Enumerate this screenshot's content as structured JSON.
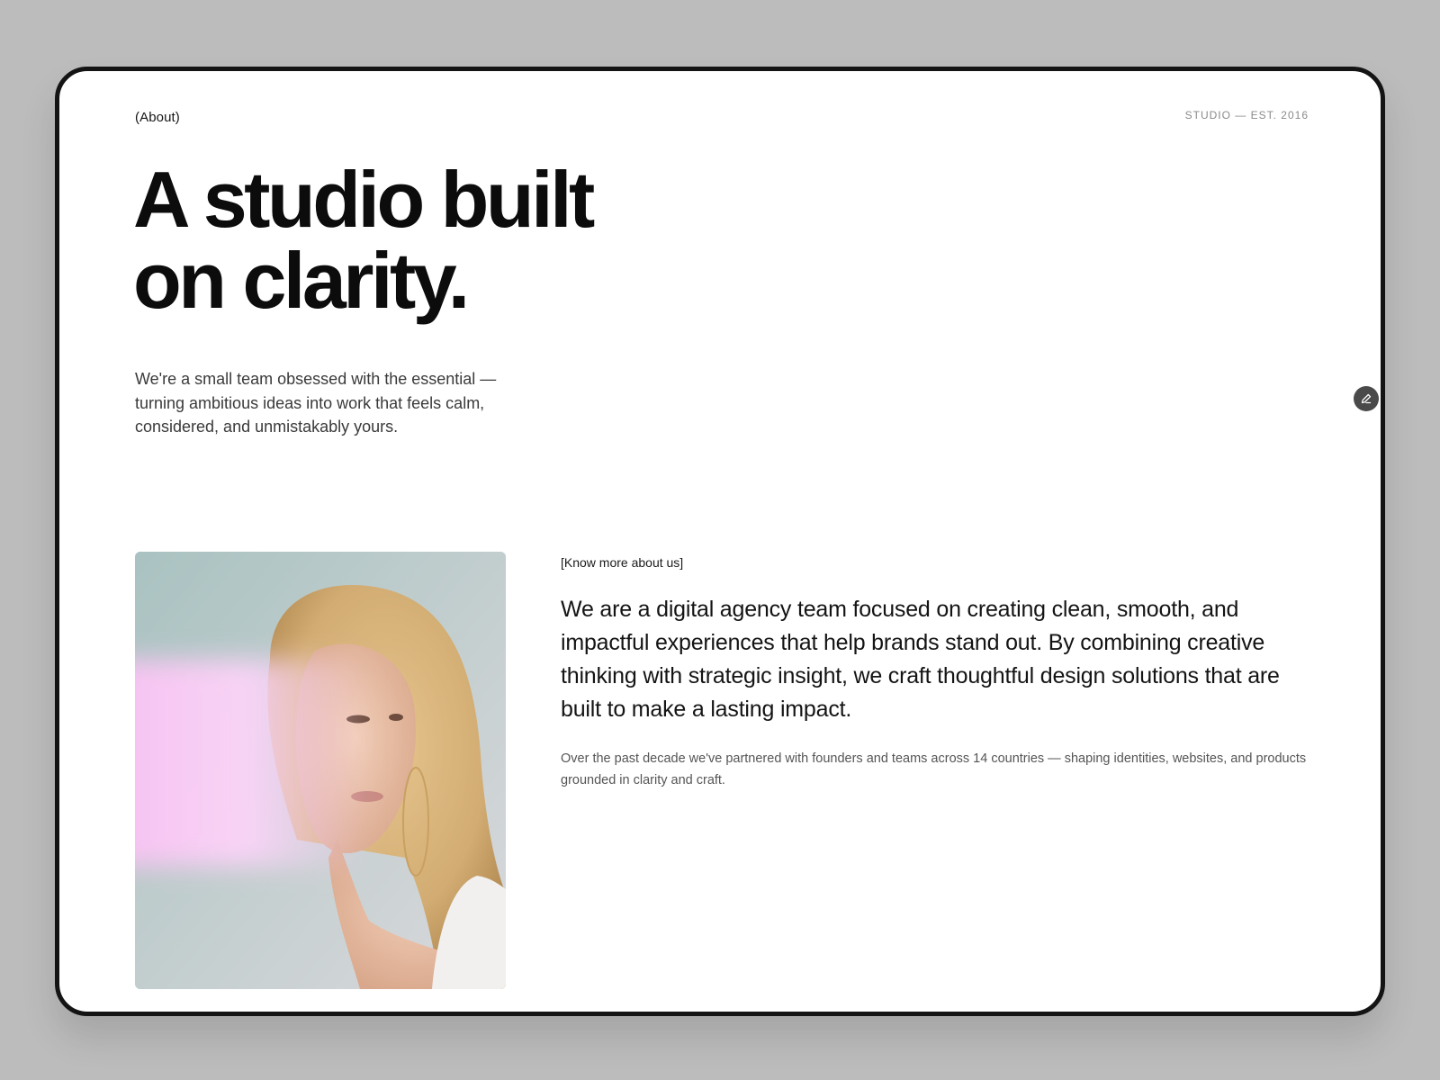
{
  "header": {
    "section_label": "(About)",
    "studio_tag": "STUDIO — EST. 2016"
  },
  "hero": {
    "headline_line1": "A studio built",
    "headline_line2": "on clarity.",
    "intro": "We're a small team obsessed with the essential — turning ambitious ideas into work that feels calm, considered, and unmistakably yours."
  },
  "about": {
    "kicker": "[Know more about us]",
    "lead": "We are a digital agency team focused on creating clean, smooth, and impactful experiences that help brands stand out. By combining creative thinking with strategic insight, we craft thoughtful design solutions that are built to make a lasting impact.",
    "body": "Over the past decade we've partnered with founders and teams across 14 countries — shaping identities, websites, and products grounded in clarity and craft."
  },
  "icons": {
    "edit": "pencil-icon"
  },
  "colors": {
    "background": "#bcbcbc",
    "frame_border": "#141414",
    "text_primary": "#0c0c0c",
    "text_muted": "#555555",
    "photo_backdrop": "#b3c9c7",
    "photo_highlight": "#f7c6f4"
  }
}
